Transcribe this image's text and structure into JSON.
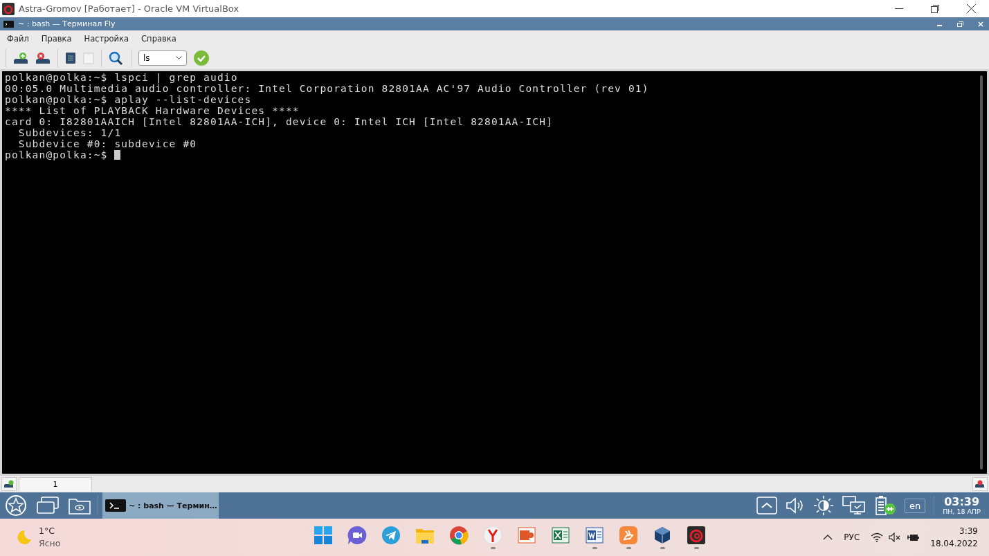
{
  "vbox_window": {
    "title": "Astra-Gromov [Работает] - Oracle VM VirtualBox"
  },
  "terminal_window": {
    "title": "~ : bash — Терминал Fly"
  },
  "menu": [
    "Файл",
    "Правка",
    "Настройка",
    "Справка"
  ],
  "toolbar": {
    "command_combo": {
      "value": "ls"
    }
  },
  "terminal": {
    "lines": [
      "polkan@polka:~$ lspci | grep audio",
      "00:05.0 Multimedia audio controller: Intel Corporation 82801AA AC'97 Audio Controller (rev 01)",
      "polkan@polka:~$ aplay --list-devices",
      "**** List of PLAYBACK Hardware Devices ****",
      "card 0: I82801AAICH [Intel 82801AA-ICH], device 0: Intel ICH [Intel 82801AA-ICH]",
      "  Subdevices: 1/1",
      "  Subdevice #0: subdevice #0"
    ],
    "prompt": "polkan@polka:~$ "
  },
  "terminal_tabs": [
    {
      "label": "1",
      "selected": true
    }
  ],
  "fly_taskbar": {
    "tasks": [
      {
        "label": "~ : bash — Термин…",
        "selected": true
      }
    ],
    "keyboard_layout": "en",
    "clock": {
      "time": "03:39",
      "date": "ПН, 18 АПР"
    }
  },
  "windows_taskbar": {
    "weather": {
      "temperature": "1°C",
      "condition": "Ясно"
    },
    "apps": [
      {
        "kind": "start",
        "running": false
      },
      {
        "kind": "video",
        "running": false
      },
      {
        "kind": "messenger",
        "running": false
      },
      {
        "kind": "folder",
        "running": false
      },
      {
        "kind": "browser",
        "running": false
      },
      {
        "kind": "yandex",
        "running": true
      },
      {
        "kind": "presentation",
        "running": false
      },
      {
        "kind": "spreadsheet",
        "running": false
      },
      {
        "kind": "document",
        "running": true
      },
      {
        "kind": "rabbit",
        "running": true
      },
      {
        "kind": "cube",
        "running": true
      },
      {
        "kind": "swirl",
        "running": true
      }
    ],
    "tray": {
      "language": "РУС",
      "time": "3:39",
      "date": "18.04.2022"
    }
  }
}
